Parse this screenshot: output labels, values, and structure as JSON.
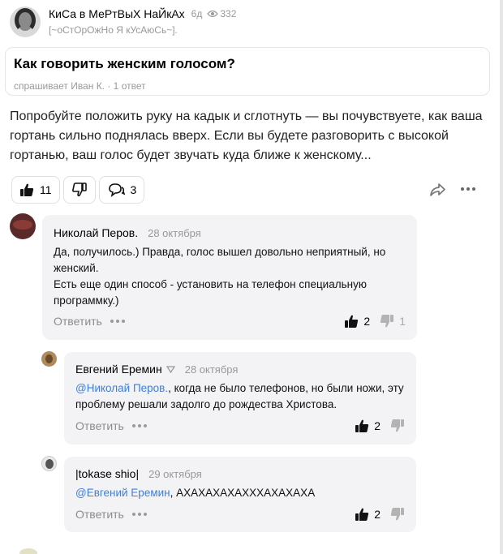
{
  "author": {
    "name": "КиСа в МеРтВыХ НаЙкАх",
    "time": "6д",
    "views": "332",
    "status": "[~оСтОрОжНо Я кУсАюСь~]."
  },
  "question": {
    "title": "Как говорить женским голосом?",
    "meta": "спрашивает Иван К. · 1 ответ"
  },
  "answer": {
    "text": "Попробуйте положить руку на кадык и сглотнуть — вы почувствуете, как ваша гортань сильно поднялась вверх. Если вы будете разговорить с высокой гортанью, ваш голос будет звучать куда ближе к женскому..."
  },
  "reactions": {
    "likes": "11",
    "comments": "3"
  },
  "comments": [
    {
      "name": "Николай Перов.",
      "date": "28 октября",
      "text": "Да, получилось.) Правда, голос вышел довольно неприятный, но женский.\nЕсть еще один способ - установить на телефон специальную программку.)",
      "reply_label": "Ответить",
      "likes": "2",
      "dislikes": "1"
    },
    {
      "name": "Евгений Еремин",
      "date": "28 октября",
      "mention": "@Николай Перов.",
      "text": ", когда не было телефонов, но были ножи, эту проблему решали задолго до рождества Христова.",
      "reply_label": "Ответить",
      "likes": "2"
    },
    {
      "name": "|tokase shio|",
      "date": "29 октября",
      "mention": "@Евгений Еремин",
      "text": ",  АХАХАХАХАХХХАХАХАХА",
      "reply_label": "Ответить",
      "likes": "2"
    }
  ],
  "colors": {
    "link": "#3e7fd8",
    "bubble": "#f3f3f5",
    "muted": "#999999"
  }
}
